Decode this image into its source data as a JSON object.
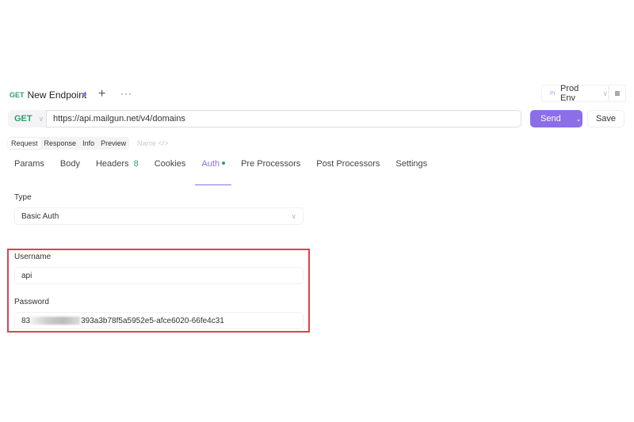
{
  "tab": {
    "method": "GET",
    "title": "New Endpoint"
  },
  "env": {
    "abbr": "Pr",
    "name": "Prod Env"
  },
  "request": {
    "method": "GET",
    "url": "https://api.mailgun.net/v4/domains",
    "send": "Send",
    "save": "Save"
  },
  "segments": [
    "Request",
    "Response",
    "Info",
    "Preview"
  ],
  "name_placeholder": "Name </>",
  "tabs": {
    "params": "Params",
    "body": "Body",
    "headers": "Headers",
    "headers_count": "8",
    "cookies": "Cookies",
    "auth": "Auth",
    "pre": "Pre Processors",
    "post": "Post Processors",
    "settings": "Settings"
  },
  "auth": {
    "type_label": "Type",
    "type_value": "Basic Auth",
    "username_label": "Username",
    "username": "api",
    "password_label": "Password",
    "password_prefix": "83",
    "password_suffix": "393a3b78f5a5952e5-afce6020-66fe4c31"
  },
  "colors": {
    "accent": "#8b6ee8",
    "get": "#2e9e6a",
    "highlight": "#d9434b"
  }
}
